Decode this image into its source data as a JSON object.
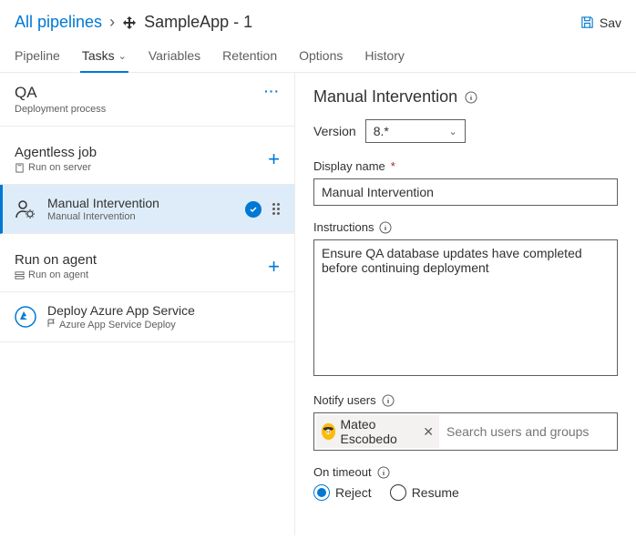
{
  "breadcrumb": {
    "root": "All pipelines",
    "current": "SampleApp - 1"
  },
  "header": {
    "save": "Sav"
  },
  "tabs": [
    "Pipeline",
    "Tasks",
    "Variables",
    "Retention",
    "Options",
    "History"
  ],
  "tabs_active_index": 1,
  "stage": {
    "name": "QA",
    "sub": "Deployment process"
  },
  "jobs": [
    {
      "title": "Agentless job",
      "sub": "Run on server",
      "tasks": [
        {
          "title": "Manual Intervention",
          "sub": "Manual Intervention",
          "selected": true
        }
      ]
    },
    {
      "title": "Run on agent",
      "sub": "Run on agent",
      "tasks": [
        {
          "title": "Deploy Azure App Service",
          "sub": "Azure App Service Deploy",
          "selected": false
        }
      ]
    }
  ],
  "panel": {
    "title": "Manual Intervention",
    "version_label": "Version",
    "version_value": "8.*",
    "display_name_label": "Display name",
    "display_name_value": "Manual Intervention",
    "instructions_label": "Instructions",
    "instructions_value": "Ensure QA database updates have completed before continuing deployment",
    "notify_label": "Notify users",
    "notify_user": "Mateo Escobedo",
    "notify_placeholder": "Search users and groups",
    "timeout_label": "On timeout",
    "timeout_options": [
      "Reject",
      "Resume"
    ],
    "timeout_selected": "Reject"
  }
}
